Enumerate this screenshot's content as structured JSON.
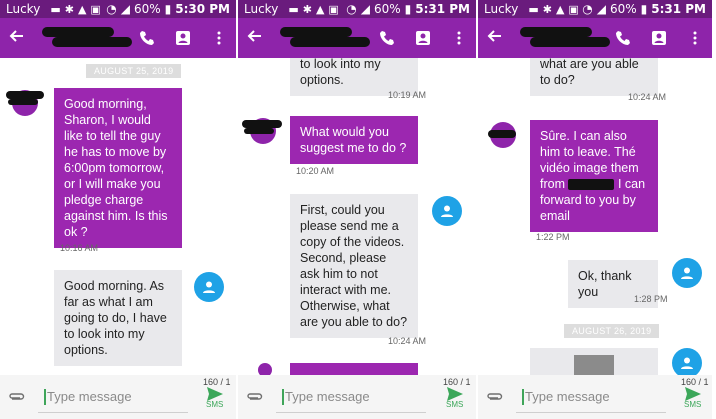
{
  "status_bar": {
    "carrier": "Lucky",
    "battery": "60%"
  },
  "screens": [
    {
      "time": "5:30 PM",
      "date_chip": "AUGUST 25, 2019",
      "messages": [
        {
          "text": "Good morning, Sharon, I would like to tell the guy he has to move by 6:00pm tomorrow, or I will make you pledge charge against him. Is this ok ?",
          "time": "10:16 AM"
        },
        {
          "text": "Good morning. As far as what I am going to do, I have to look into my options."
        }
      ]
    },
    {
      "time": "5:31 PM",
      "messages": [
        {
          "text": "to look into my options.",
          "time": "10:19 AM"
        },
        {
          "text": "What would you suggest me to do ?",
          "time": "10:20 AM"
        },
        {
          "text": "First, could you please send me a copy of the videos. Second, please ask him to not interact with me. Otherwise, what are you able to do?",
          "time": "10:24 AM"
        }
      ]
    },
    {
      "time": "5:31 PM",
      "date_chip": "AUGUST 26, 2019",
      "messages": [
        {
          "text": "what are you able to do?",
          "time": "10:24 AM"
        },
        {
          "text_a": "Sûre. I can also him to leave. Thé vidéo image them from",
          "text_b": "I can forward to you by email",
          "time": "1:22 PM"
        },
        {
          "text": "Ok, thank you",
          "time": "1:28 PM"
        }
      ]
    }
  ],
  "composer": {
    "placeholder": "Type message",
    "counter": "160 / 1",
    "send_label": "SMS"
  },
  "colors": {
    "status": "#6a1b7d",
    "appbar": "#8e24aa",
    "outgoing": "#9c27b0",
    "incoming": "#e9e9ec",
    "avatar": "#1fa2e6",
    "send": "#3ca75a"
  },
  "icons": [
    "back-arrow-icon",
    "phone-icon",
    "contact-card-icon",
    "overflow-menu-icon",
    "person-icon",
    "attach-icon",
    "send-icon"
  ]
}
